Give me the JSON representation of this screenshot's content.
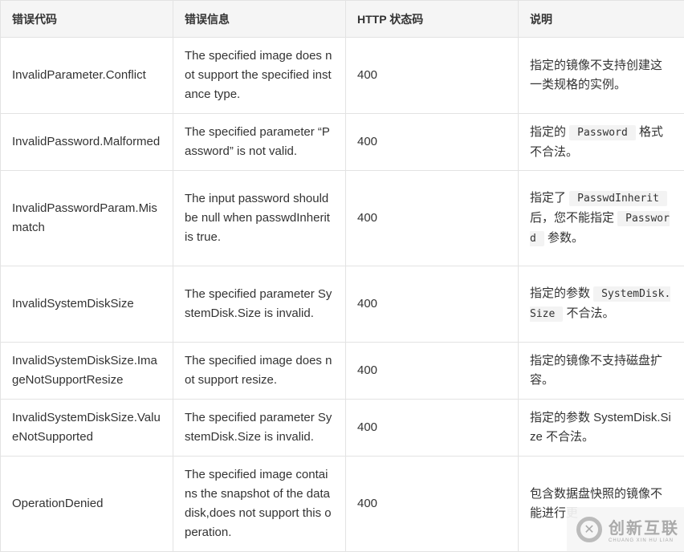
{
  "headers": [
    "错误代码",
    "错误信息",
    "HTTP 状态码",
    "说明"
  ],
  "rows": [
    {
      "code": "InvalidParameter.Conflict",
      "msg": "The specified image does not support the specified instance type.",
      "status": "400",
      "desc": [
        {
          "t": "指定的镜像不支持创建这一类规格的实例。"
        }
      ]
    },
    {
      "code": "InvalidPassword.Malformed",
      "msg": "The specified parameter “Password” is not valid.",
      "status": "400",
      "desc": [
        {
          "t": "指定的 "
        },
        {
          "c": "Password"
        },
        {
          "t": " 格式不合法。"
        }
      ]
    },
    {
      "code": "InvalidPasswordParam.Mismatch",
      "msg": "The input password should be null when passwdInherit is true.",
      "status": "400",
      "desc": [
        {
          "t": "指定了 "
        },
        {
          "c": "PasswdInherit"
        },
        {
          "t": " 后，您不能指定 "
        },
        {
          "c": "Password"
        },
        {
          "t": " 参数。"
        }
      ]
    },
    {
      "code": "InvalidSystemDiskSize",
      "msg": "The specified parameter SystemDisk.Size is invalid.",
      "status": "400",
      "desc": [
        {
          "t": "指定的参数 "
        },
        {
          "c": "SystemDisk.Size"
        },
        {
          "t": " 不合法。"
        }
      ]
    },
    {
      "code": "InvalidSystemDiskSize.ImageNotSupportResize",
      "msg": "The specified image does not support resize.",
      "status": "400",
      "desc": [
        {
          "t": "指定的镜像不支持磁盘扩容。"
        }
      ]
    },
    {
      "code": "InvalidSystemDiskSize.ValueNotSupported",
      "msg": "The specified parameter SystemDisk.Size is invalid.",
      "status": "400",
      "desc": [
        {
          "t": "指定的参数 SystemDisk.Size 不合法。"
        }
      ]
    },
    {
      "code": "OperationDenied",
      "msg": "The specified image contains the snapshot of the data disk,does not support this operation.",
      "status": "400",
      "desc": [
        {
          "t": "包含数据盘快照的镜像不能进行更"
        }
      ]
    }
  ],
  "watermark": {
    "name": "创新互联",
    "pinyin": "CHUANG XIN HU LIAN"
  }
}
